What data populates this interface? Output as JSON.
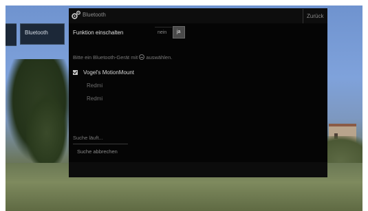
{
  "side_nav": {
    "active_item": "Bluetooth"
  },
  "dialog": {
    "title": "Bluetooth",
    "back_label": "Zurück",
    "function_label": "Funktion einschalten",
    "toggle": {
      "off_label": "nein",
      "on_label": "ja",
      "selected": "ja"
    },
    "hint_before_icon": "Bitte ein Bluetooth-Gerät mit",
    "hint_after_icon": "auswählen.",
    "devices": [
      {
        "label": "Vogel's MotionMount",
        "checked": true
      },
      {
        "label": "Redmi",
        "checked": false
      },
      {
        "label": "Redmi",
        "checked": false
      }
    ],
    "status": "Suche läuft...",
    "cancel_label": "Suche abbrechen"
  },
  "icons": {
    "title_icon": "bluetooth-gear-icon",
    "ok_icon": "ok-button-icon"
  },
  "colors": {
    "panel_bg": "#050505",
    "side_button_bg": "#1c2838",
    "selected_toggle": "#4a4a4a"
  }
}
